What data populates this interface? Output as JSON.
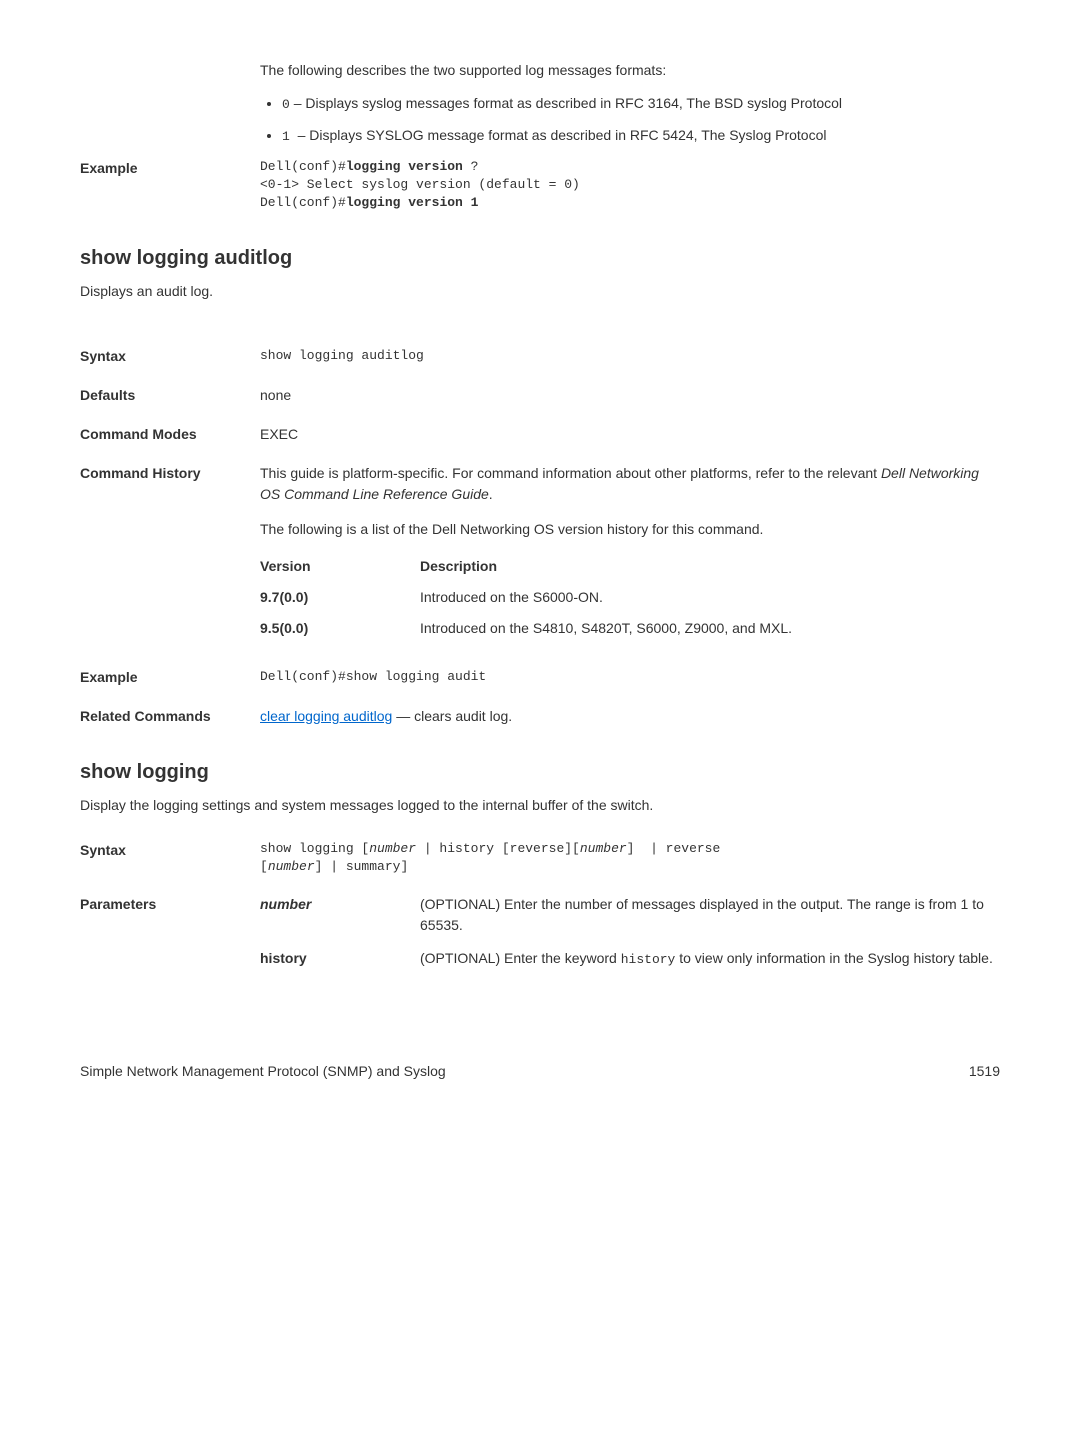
{
  "top": {
    "intro": "The following describes the two supported log messages formats:",
    "bullet1_pre": "0",
    "bullet1_post": " – Displays syslog messages format as described in RFC 3164, The BSD syslog Protocol",
    "bullet2_pre": "1 ",
    "bullet2_post": " – Displays SYSLOG message format as described in RFC 5424, The Syslog Protocol"
  },
  "example1": {
    "label": "Example",
    "line1_pre": "Dell(conf)#",
    "line1_bold": "logging version ",
    "line1_post": "?",
    "line2": "<0-1> Select syslog version (default = 0)",
    "line3_pre": "Dell(conf)#",
    "line3_bold": "logging version 1"
  },
  "section2": {
    "title": "show logging auditlog",
    "desc": "Displays an audit log.",
    "syntax_label": "Syntax",
    "syntax_value": "show logging auditlog",
    "defaults_label": "Defaults",
    "defaults_value": "none",
    "modes_label": "Command Modes",
    "modes_value": "EXEC",
    "history_label": "Command History",
    "history_p1_a": "This guide is platform-specific. For command information about other platforms, refer to the relevant ",
    "history_p1_italic": "Dell Networking OS Command Line Reference Guide",
    "history_p1_b": ".",
    "history_p2": "The following is a list of the Dell Networking OS version history for this command.",
    "vt_h1": "Version",
    "vt_h2": "Description",
    "vt_r1c1": "9.7(0.0)",
    "vt_r1c2": "Introduced on the S6000-ON.",
    "vt_r2c1": "9.5(0.0)",
    "vt_r2c2": "Introduced on the S4810, S4820T, S6000, Z9000, and MXL.",
    "ex_label": "Example",
    "ex_value": "Dell(conf)#show logging audit",
    "rel_label": "Related Commands",
    "rel_link": "clear logging auditlog",
    "rel_post": " — clears audit log."
  },
  "section3": {
    "title": "show logging",
    "desc": "Display the logging settings and system messages logged to the internal buffer of the switch.",
    "syntax_label": "Syntax",
    "syntax_l1_a": "show logging [",
    "syntax_l1_i1": "number",
    "syntax_l1_b": " | history [reverse][",
    "syntax_l1_i2": "number",
    "syntax_l1_c": "]  | reverse ",
    "syntax_l2_a": "[",
    "syntax_l2_i": "number",
    "syntax_l2_b": "] | summary]",
    "params_label": "Parameters",
    "p1_name": "number",
    "p1_desc": "(OPTIONAL) Enter the number of messages displayed in the output. The range is from 1 to 65535.",
    "p2_name": "history",
    "p2_desc_a": "(OPTIONAL) Enter the keyword ",
    "p2_desc_mono": "history",
    "p2_desc_b": " to view only information in the Syslog history table."
  },
  "footer": {
    "left": "Simple Network Management Protocol (SNMP) and Syslog",
    "right": "1519"
  }
}
